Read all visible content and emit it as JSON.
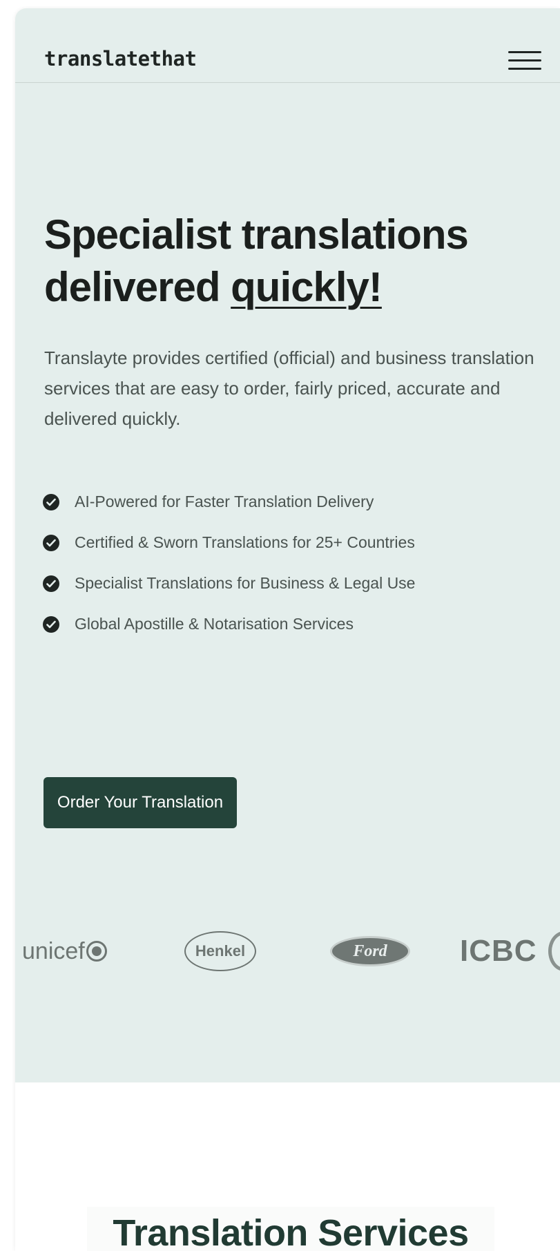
{
  "header": {
    "logo": "translatethat",
    "menu_icon": "hamburger-menu-icon"
  },
  "hero": {
    "headline_part1": "Specialist translations delivered ",
    "headline_accent": "quickly!",
    "intro": "Translayte provides certified (official) and business translation services that are easy to order, fairly priced, accurate and delivered quickly.",
    "features": [
      "AI-Powered for Faster Translation Delivery",
      "Certified & Sworn Translations for 25+ Countries",
      "Specialist Translations for Business & Legal Use",
      "Global Apostille & Notarisation Services"
    ],
    "cta_label": "Order Your Translation"
  },
  "clients": {
    "logos": [
      "unicef",
      "Henkel",
      "Ford",
      "ICBC"
    ]
  },
  "services": {
    "title": "Translation Services"
  },
  "colors": {
    "hero_bg": "#e4eeec",
    "accent": "#24443a",
    "text": "#1b1f1d",
    "muted": "#4a5350"
  }
}
